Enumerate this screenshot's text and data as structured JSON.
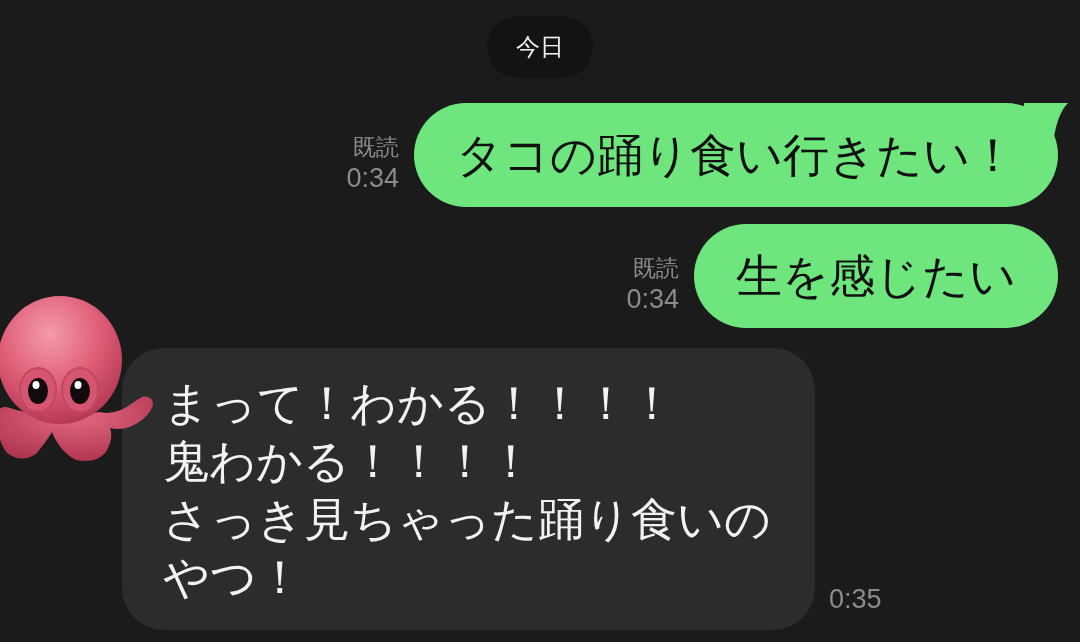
{
  "date_separator": "今日",
  "messages": [
    {
      "kind": "sent",
      "text": "タコの踊り食い行きたい！",
      "read_status": "既読",
      "time": "0:34",
      "tail": true
    },
    {
      "kind": "sent",
      "text": "生を感じたい",
      "read_status": "既読",
      "time": "0:34",
      "tail": false
    },
    {
      "kind": "received",
      "lines": [
        "まって！わかる！！！！",
        "鬼わかる！！！！",
        "さっき見ちゃった踊り食いの",
        "やつ！"
      ],
      "time": "0:35"
    }
  ]
}
